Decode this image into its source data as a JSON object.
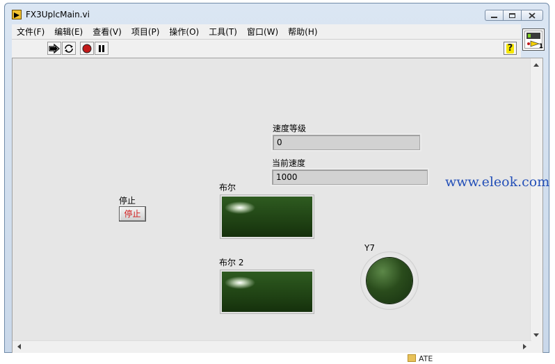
{
  "window": {
    "title": "FX3UplcMain.vi",
    "controls": {
      "minimize": "minimize",
      "maximize": "maximize",
      "close": "close"
    }
  },
  "menubar": {
    "items": [
      {
        "label": "文件(F)"
      },
      {
        "label": "编辑(E)"
      },
      {
        "label": "查看(V)"
      },
      {
        "label": "项目(P)"
      },
      {
        "label": "操作(O)"
      },
      {
        "label": "工具(T)"
      },
      {
        "label": "窗口(W)"
      },
      {
        "label": "帮助(H)"
      }
    ]
  },
  "toolbar": {
    "buttons": [
      "run-arrow-icon",
      "run-continuously-icon",
      "abort-icon",
      "pause-icon"
    ],
    "help": "?",
    "vi_icon_number": "1"
  },
  "panel": {
    "speed_level": {
      "label": "速度等级",
      "value": "0"
    },
    "current_speed": {
      "label": "当前速度",
      "value": "1000"
    },
    "bool1": {
      "label": "布尔"
    },
    "bool2": {
      "label": "布尔 2"
    },
    "stop": {
      "label": "停止",
      "button_text": "停止"
    },
    "y7": {
      "label": "Y7"
    }
  },
  "watermark": "www.eleok.com",
  "desktop": {
    "item_label": "ATE"
  },
  "colors": {
    "panel_bg": "#e6e6e6",
    "led_off_green": "#1d3e12",
    "stop_text": "#d01818",
    "watermark": "#2450b8"
  }
}
